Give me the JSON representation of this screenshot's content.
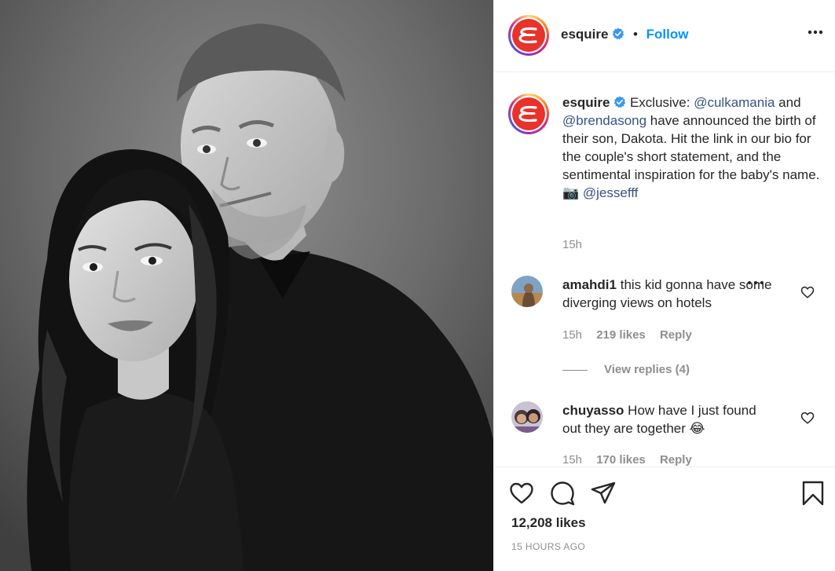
{
  "account": {
    "username": "esquire",
    "follow_label": "Follow",
    "separator": "•",
    "logo_letter": "E",
    "brand_color": "#e8322b",
    "verified_color": "#3897f0"
  },
  "caption": {
    "username": "esquire",
    "text_before": "Exclusive: ",
    "mention1": "@culkamania",
    "text_mid1": " and ",
    "mention2": "@brendasong",
    "text_mid2": " have announced the birth of their son, Dakota. Hit the link in our bio for the couple's short statement, and the sentimental inspiration for the baby's name. 📷 ",
    "mention3": "@jessefff",
    "time": "15h"
  },
  "comments": [
    {
      "username": "amahdi1",
      "text": "this kid gonna have some diverging views on hotels",
      "time": "15h",
      "likes": "219 likes",
      "reply": "Reply",
      "view_replies": "View replies (4)"
    },
    {
      "username": "chuyasso",
      "text": "How have I just found out they are together 😂",
      "time": "15h",
      "likes": "170 likes",
      "reply": "Reply"
    }
  ],
  "footer": {
    "likes": "12,208 likes",
    "posted": "15 HOURS AGO"
  },
  "icons": {
    "like": "heart-icon",
    "comment": "comment-icon",
    "share": "paper-plane-icon",
    "save": "bookmark-icon",
    "options": "more-options-icon"
  }
}
